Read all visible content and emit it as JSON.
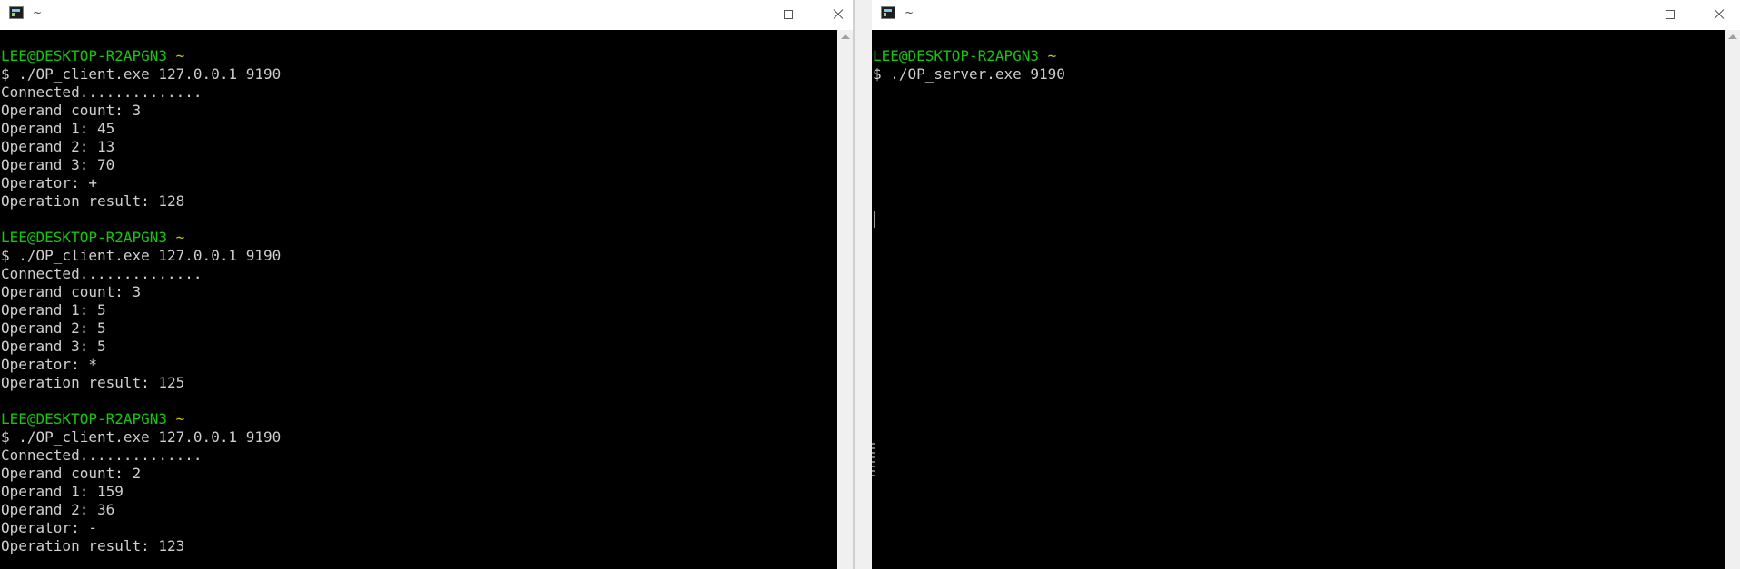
{
  "left_window": {
    "title": "~",
    "buttons": {
      "minimize": "Minimize",
      "maximize": "Maximize",
      "close": "Close"
    },
    "sessions": [
      {
        "user_host": "LEE@DESKTOP-R2APGN3",
        "tilde": "~",
        "command": "$ ./OP_client.exe 127.0.0.1 9190",
        "output": [
          "Connected..............",
          "Operand count: 3",
          "Operand 1: 45",
          "Operand 2: 13",
          "Operand 3: 70",
          "Operator: +",
          "Operation result: 128"
        ]
      },
      {
        "user_host": "LEE@DESKTOP-R2APGN3",
        "tilde": "~",
        "command": "$ ./OP_client.exe 127.0.0.1 9190",
        "output": [
          "Connected..............",
          "Operand count: 3",
          "Operand 1: 5",
          "Operand 2: 5",
          "Operand 3: 5",
          "Operator: *",
          "Operation result: 125"
        ]
      },
      {
        "user_host": "LEE@DESKTOP-R2APGN3",
        "tilde": "~",
        "command": "$ ./OP_client.exe 127.0.0.1 9190",
        "output": [
          "Connected..............",
          "Operand count: 2",
          "Operand 1: 159",
          "Operand 2: 36",
          "Operator: -",
          "Operation result: 123"
        ]
      }
    ]
  },
  "right_window": {
    "title": "~",
    "buttons": {
      "minimize": "Minimize",
      "maximize": "Maximize",
      "close": "Close"
    },
    "sessions": [
      {
        "user_host": "LEE@DESKTOP-R2APGN3",
        "tilde": "~",
        "command": "$ ./OP_server.exe 9190",
        "output": []
      }
    ]
  },
  "colors": {
    "prompt": "#16c60c",
    "tilde": "#c8c800",
    "text": "#cfcfcf",
    "background": "#000000"
  }
}
